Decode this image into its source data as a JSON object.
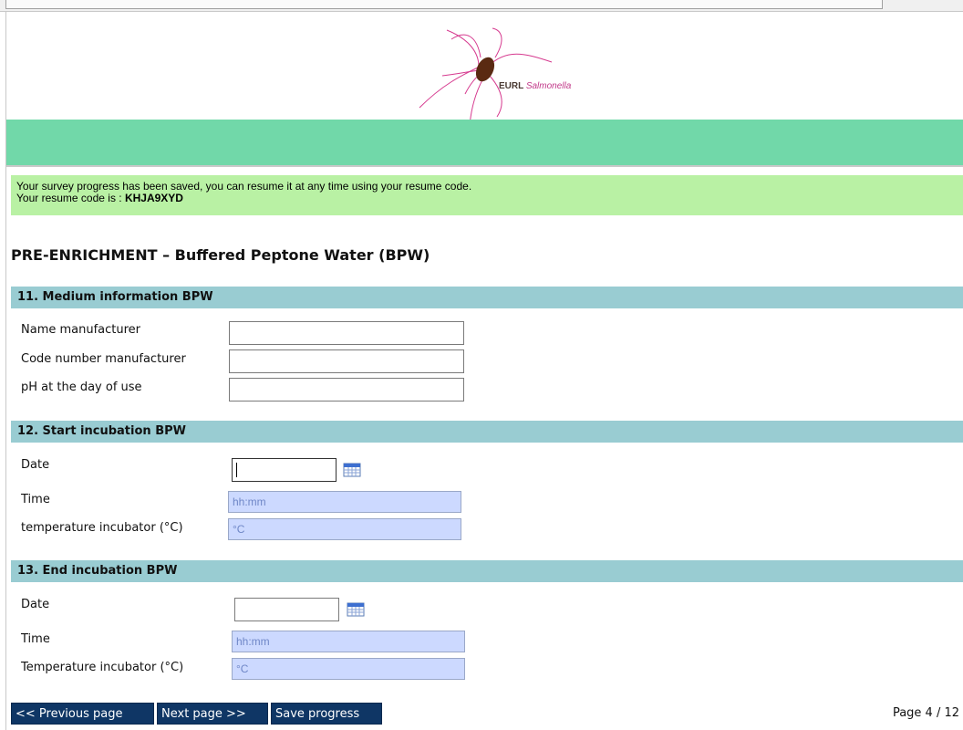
{
  "branding": {
    "logo_text_bold": "EURL",
    "logo_text_italic": "Salmonella"
  },
  "notice": {
    "line1": "Your survey progress has been saved, you can resume it at any time using your resume code.",
    "resume_prefix": "Your resume code is : ",
    "resume_code": "KHJA9XYD"
  },
  "page_title": "PRE-ENRICHMENT – Buffered Peptone Water (BPW)",
  "section11": {
    "title": "11. Medium information BPW",
    "fields": [
      {
        "label": "Name manufacturer",
        "value": ""
      },
      {
        "label": "Code number manufacturer",
        "value": ""
      },
      {
        "label": "pH at the day of use",
        "value": ""
      }
    ]
  },
  "section12": {
    "title": "12. Start incubation BPW",
    "date_label": "Date",
    "date_value": "",
    "time_label": "Time",
    "time_placeholder": "hh:mm",
    "temp_label": "temperature incubator (°C)",
    "temp_placeholder": "°C"
  },
  "section13": {
    "title": "13. End incubation BPW",
    "date_label": "Date",
    "date_value": "",
    "time_label": "Time",
    "time_placeholder": "hh:mm",
    "temp_label": "Temperature incubator (°C)",
    "temp_placeholder": "°C"
  },
  "buttons": {
    "previous": "<< Previous page",
    "next": "Next page >>",
    "save": "Save progress"
  },
  "pagination": "Page 4 / 12",
  "colors": {
    "band": "#71d8a9",
    "notice_bg": "#b9f1a4",
    "section_head": "#99ccd2",
    "button_bg": "#0f3665",
    "input_blue": "#ccd9ff"
  },
  "icons": {
    "calendar": "calendar-icon"
  }
}
